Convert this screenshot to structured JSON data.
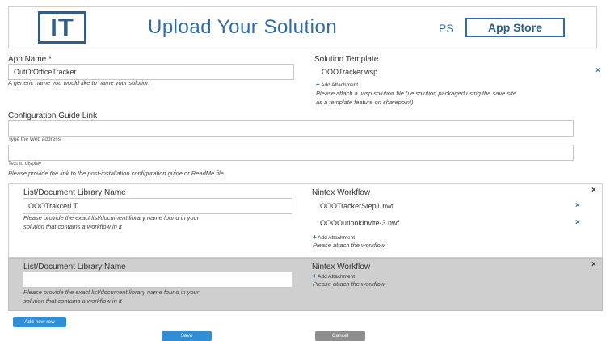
{
  "header": {
    "logo_text": "IT",
    "title": "Upload Your Solution",
    "ps_label": "PS",
    "app_store_label": "App Store"
  },
  "app_name": {
    "label": "App Name *",
    "value": "OutOfOfficeTracker",
    "hint": "A generic name you would like to name your solution"
  },
  "solution_template": {
    "label": "Solution Template",
    "file": "OOOTracker.wsp",
    "add_attachment": "Add Attachment",
    "hint_line1": "Please attach a .wsp solution file (i.e solution packaged using the save site",
    "hint_line2": "as a template feature on sharepoint)"
  },
  "config_guide": {
    "label": "Configuration Guide Link",
    "web_address_label": "Type the Web address",
    "text_display_label": "Text to display",
    "hint": "Please provide the link to the post-installation configuration guide or ReadMe file."
  },
  "rows": [
    {
      "list_label": "List/Document Library Name",
      "list_value": "OOOTrakcerLT",
      "list_hint_line1": "Please provide the exact list/document library name found in your",
      "list_hint_line2": "solution that contains a workflow in it",
      "workflow_label": "Nintex Workflow",
      "files": [
        "OOOTrackerStep1.nwf",
        "OOOOutlookInvite-3.nwf"
      ],
      "add_attachment": "Add Attachment",
      "workflow_hint": "Please attach the workflow"
    },
    {
      "list_label": "List/Document Library Name",
      "list_value": "",
      "list_hint_line1": "Please provide the exact list/document library name found in your",
      "list_hint_line2": "solution that contains a workflow in it",
      "workflow_label": "Nintex Workflow",
      "files": [],
      "add_attachment": "Add Attachment",
      "workflow_hint": "Please attach the workflow"
    }
  ],
  "buttons": {
    "add_new_row": "Add new row",
    "save": "Save",
    "cancel": "Cancel"
  },
  "icons": {
    "remove": "×",
    "plus": "+"
  },
  "colors": {
    "brand_blue": "#2e6da4",
    "button_blue": "#2f8ed6",
    "button_gray": "#8e8e8e",
    "row_gray": "#cfcfcf"
  }
}
